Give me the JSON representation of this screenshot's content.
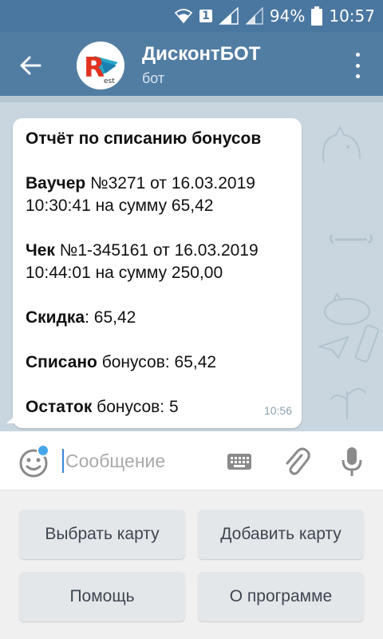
{
  "status_bar": {
    "sim_slot": "1",
    "battery": "94%",
    "time": "10:57"
  },
  "header": {
    "title": "ДисконтБОТ",
    "subtitle": "бот",
    "avatar_letter": "R",
    "avatar_text": "est"
  },
  "message": {
    "title": "Отчёт по списанию бонусов",
    "voucher_label": "Ваучер",
    "voucher_line1": " №3271 от 16.03.2019",
    "voucher_line2": "10:30:41 на сумму 65,42",
    "check_label": "Чек",
    "check_line1": " №1-345161 от 16.03.2019",
    "check_line2": "10:44:01 на сумму 250,00",
    "discount_label": "Скидка",
    "discount_value": ": 65,42",
    "written_off_label": "Списано",
    "written_off_value": " бонусов: 65,42",
    "balance_label": "Остаток",
    "balance_value": " бонусов: 5",
    "time": "10:56"
  },
  "input": {
    "placeholder": "Сообщение"
  },
  "keyboard": {
    "buttons": [
      "Выбрать карту",
      "Добавить карту",
      "Помощь",
      "О программе"
    ]
  },
  "colors": {
    "header": "#527da3",
    "status_bar": "#4a77a0",
    "chat_bg": "#c9d6df",
    "accent": "#46a6ea"
  }
}
